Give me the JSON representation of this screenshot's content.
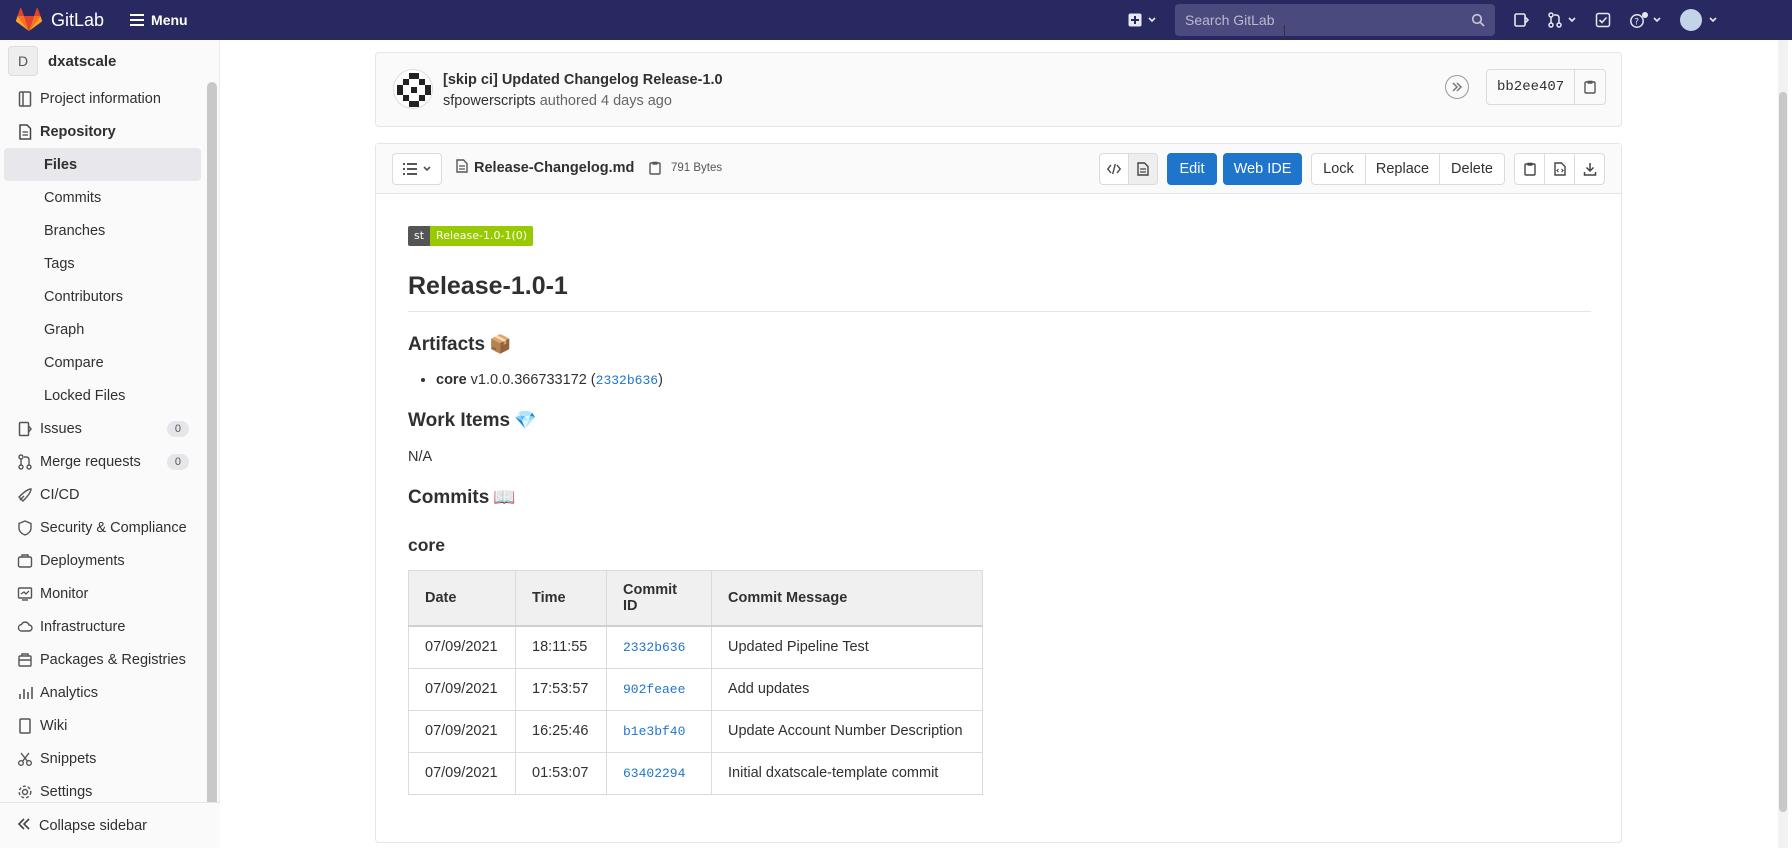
{
  "topbar": {
    "brand": "GitLab",
    "menu_label": "Menu",
    "search_placeholder": "Search GitLab"
  },
  "sidebar": {
    "project_initial": "D",
    "project_name": "dxatscale",
    "items": {
      "project_information": "Project information",
      "repository": "Repository",
      "files": "Files",
      "commits": "Commits",
      "branches": "Branches",
      "tags": "Tags",
      "contributors": "Contributors",
      "graph": "Graph",
      "compare": "Compare",
      "locked_files": "Locked Files",
      "issues": "Issues",
      "issues_count": "0",
      "merge_requests": "Merge requests",
      "merge_requests_count": "0",
      "cicd": "CI/CD",
      "security": "Security & Compliance",
      "deployments": "Deployments",
      "monitor": "Monitor",
      "infrastructure": "Infrastructure",
      "packages": "Packages & Registries",
      "analytics": "Analytics",
      "wiki": "Wiki",
      "snippets": "Snippets",
      "settings": "Settings"
    },
    "collapse_label": "Collapse sidebar"
  },
  "commit": {
    "title": "[skip ci] Updated Changelog Release-1.0",
    "author": "sfpowerscripts",
    "authored_text": "authored 4 days ago",
    "sha": "bb2ee407"
  },
  "file": {
    "name": "Release-Changelog.md",
    "size": "791 Bytes",
    "buttons": {
      "edit": "Edit",
      "web_ide": "Web IDE",
      "lock": "Lock",
      "replace": "Replace",
      "delete": "Delete"
    }
  },
  "markdown": {
    "badge_left": "st",
    "badge_right": "Release-1.0-1(0)",
    "h1": "Release-1.0-1",
    "artifacts_heading": "Artifacts",
    "artifacts_emoji": "📦",
    "artifact": {
      "name": "core",
      "version": "v1.0.0.366733172 (",
      "commit": "2332b636",
      "close": ")"
    },
    "work_items_heading": "Work Items",
    "work_items_emoji": "💎",
    "work_items_value": "N/A",
    "commits_heading": "Commits",
    "commits_emoji": "📖",
    "core_heading": "core",
    "table": {
      "headers": [
        "Date",
        "Time",
        "Commit ID",
        "Commit Message"
      ],
      "rows": [
        [
          "07/09/2021",
          "18:11:55",
          "2332b636",
          "Updated Pipeline Test"
        ],
        [
          "07/09/2021",
          "17:53:57",
          "902feaee",
          "Add updates"
        ],
        [
          "07/09/2021",
          "16:25:46",
          "b1e3bf40",
          "Update Account Number Description"
        ],
        [
          "07/09/2021",
          "01:53:07",
          "63402294",
          "Initial dxatscale-template commit"
        ]
      ]
    }
  },
  "colors": {
    "navbar": "#292961",
    "primary": "#1f75cb",
    "badge_green": "#97ca00"
  }
}
